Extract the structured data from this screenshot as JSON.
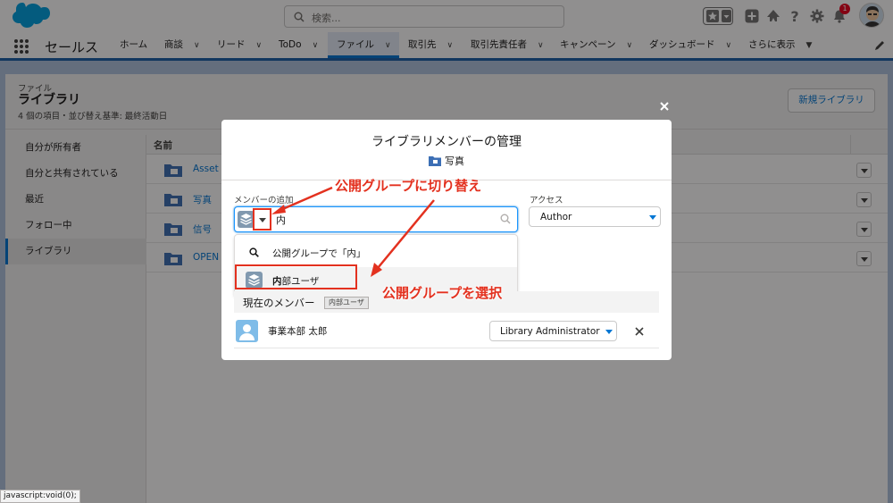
{
  "header": {
    "search_placeholder": "検索...",
    "notification_count": "1"
  },
  "nav": {
    "app_name": "セールス",
    "items": [
      {
        "label": "ホーム",
        "chev": ""
      },
      {
        "label": "商談",
        "chev": "∨"
      },
      {
        "label": "リード",
        "chev": "∨"
      },
      {
        "label": "ToDo",
        "chev": "∨"
      },
      {
        "label": "ファイル",
        "chev": "∨"
      },
      {
        "label": "取引先",
        "chev": "∨"
      },
      {
        "label": "取引先責任者",
        "chev": "∨"
      },
      {
        "label": "キャンペーン",
        "chev": "∨"
      },
      {
        "label": "ダッシュボード",
        "chev": "∨"
      },
      {
        "label": "さらに表示",
        "chev": "▼"
      }
    ]
  },
  "page": {
    "object_label": "ファイル",
    "title": "ライブラリ",
    "subtitle": "4 個の項目・並び替え基準: 最終活動日",
    "new_button": "新規ライブラリ",
    "sidebar": [
      "自分が所有者",
      "自分と共有されている",
      "最近",
      "フォロー中",
      "ライブラリ"
    ],
    "column_name": "名前",
    "rows": [
      "Asset l",
      "写真",
      "信号",
      "OPEN"
    ]
  },
  "modal": {
    "title": "ライブラリメンバーの管理",
    "library_name": "写真",
    "add_label": "メンバーの追加",
    "add_value": "内",
    "access_label": "アクセス",
    "access_value": "Author",
    "dropdown_search": "公開グループで「内」",
    "dropdown_option_bold": "内",
    "dropdown_option_rest": "部ユーザ",
    "current_members_label": "現在のメンバー",
    "tooltip": "内部ユーザ",
    "member_name": "事業本部 太郎",
    "member_role": "Library Administrator"
  },
  "annotations": {
    "switch_label": "公開グループに切り替え",
    "select_label": "公開グループを選択"
  },
  "statusbar": "javascript:void(0);",
  "colors": {
    "brand_blue": "#0176d3",
    "nav_underline": "#1b5fa8",
    "annotation_red": "#e3311f",
    "group_icon": "#8199af"
  },
  "icons": [
    "cloud-logo-icon",
    "search-icon",
    "favorites-star-icon",
    "add-icon",
    "trailhead-icon",
    "help-icon",
    "gear-icon",
    "bell-icon",
    "waffle-icon",
    "pencil-icon",
    "folder-library-icon",
    "close-icon",
    "group-icon",
    "user-icon"
  ]
}
